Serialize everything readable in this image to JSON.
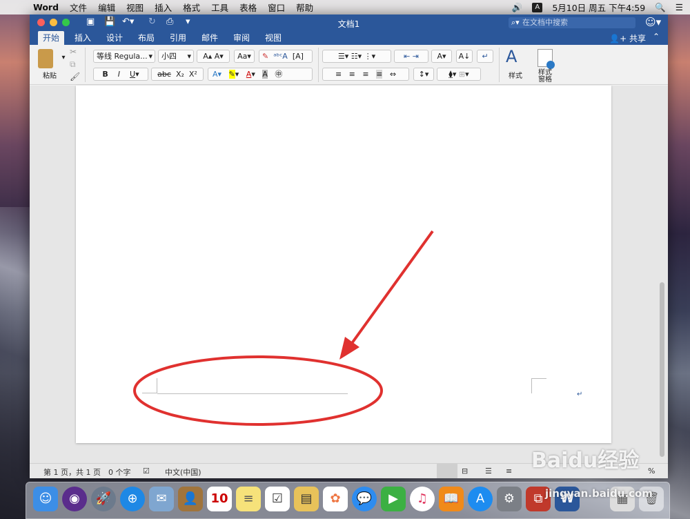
{
  "menubar": {
    "app": "Word",
    "items": [
      "文件",
      "编辑",
      "视图",
      "插入",
      "格式",
      "工具",
      "表格",
      "窗口",
      "帮助"
    ],
    "input_indicator": "A",
    "clock": "5月10日 周五 下午4:59"
  },
  "window": {
    "title": "文档1",
    "search_placeholder": "在文档中搜索",
    "share": "共享"
  },
  "tabs": [
    {
      "label": "开始",
      "active": true
    },
    {
      "label": "插入"
    },
    {
      "label": "设计"
    },
    {
      "label": "布局"
    },
    {
      "label": "引用"
    },
    {
      "label": "邮件"
    },
    {
      "label": "审阅"
    },
    {
      "label": "视图"
    }
  ],
  "ribbon": {
    "paste": "粘贴",
    "font_name": "等线 Regula...",
    "font_size": "小四",
    "bold": "B",
    "italic": "I",
    "underline": "U",
    "strike": "abc",
    "subscript": "X₂",
    "superscript": "X²",
    "styles": "样式",
    "styles_pane": "样式\n窗格"
  },
  "document": {
    "paragraph_mark": "↵"
  },
  "statusbar": {
    "page": "第 1 页，共 1 页",
    "words": "0 个字",
    "language": "中文(中国)",
    "zoom": "%"
  },
  "watermark": {
    "brand": "Baidu经验",
    "url": "jingyan.baidu.com"
  },
  "colors": {
    "word_blue": "#2b579a",
    "annotation_red": "#e0312f"
  }
}
